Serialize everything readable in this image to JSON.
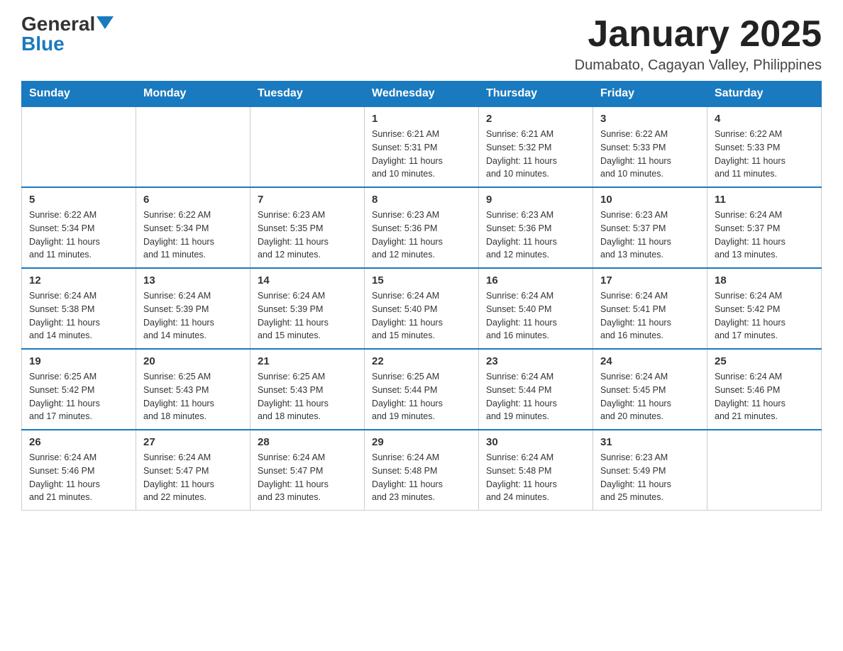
{
  "logo": {
    "general": "General",
    "triangle": "",
    "blue": "Blue"
  },
  "title": "January 2025",
  "subtitle": "Dumabato, Cagayan Valley, Philippines",
  "days_header": [
    "Sunday",
    "Monday",
    "Tuesday",
    "Wednesday",
    "Thursday",
    "Friday",
    "Saturday"
  ],
  "weeks": [
    [
      {
        "day": "",
        "info": ""
      },
      {
        "day": "",
        "info": ""
      },
      {
        "day": "",
        "info": ""
      },
      {
        "day": "1",
        "info": "Sunrise: 6:21 AM\nSunset: 5:31 PM\nDaylight: 11 hours\nand 10 minutes."
      },
      {
        "day": "2",
        "info": "Sunrise: 6:21 AM\nSunset: 5:32 PM\nDaylight: 11 hours\nand 10 minutes."
      },
      {
        "day": "3",
        "info": "Sunrise: 6:22 AM\nSunset: 5:33 PM\nDaylight: 11 hours\nand 10 minutes."
      },
      {
        "day": "4",
        "info": "Sunrise: 6:22 AM\nSunset: 5:33 PM\nDaylight: 11 hours\nand 11 minutes."
      }
    ],
    [
      {
        "day": "5",
        "info": "Sunrise: 6:22 AM\nSunset: 5:34 PM\nDaylight: 11 hours\nand 11 minutes."
      },
      {
        "day": "6",
        "info": "Sunrise: 6:22 AM\nSunset: 5:34 PM\nDaylight: 11 hours\nand 11 minutes."
      },
      {
        "day": "7",
        "info": "Sunrise: 6:23 AM\nSunset: 5:35 PM\nDaylight: 11 hours\nand 12 minutes."
      },
      {
        "day": "8",
        "info": "Sunrise: 6:23 AM\nSunset: 5:36 PM\nDaylight: 11 hours\nand 12 minutes."
      },
      {
        "day": "9",
        "info": "Sunrise: 6:23 AM\nSunset: 5:36 PM\nDaylight: 11 hours\nand 12 minutes."
      },
      {
        "day": "10",
        "info": "Sunrise: 6:23 AM\nSunset: 5:37 PM\nDaylight: 11 hours\nand 13 minutes."
      },
      {
        "day": "11",
        "info": "Sunrise: 6:24 AM\nSunset: 5:37 PM\nDaylight: 11 hours\nand 13 minutes."
      }
    ],
    [
      {
        "day": "12",
        "info": "Sunrise: 6:24 AM\nSunset: 5:38 PM\nDaylight: 11 hours\nand 14 minutes."
      },
      {
        "day": "13",
        "info": "Sunrise: 6:24 AM\nSunset: 5:39 PM\nDaylight: 11 hours\nand 14 minutes."
      },
      {
        "day": "14",
        "info": "Sunrise: 6:24 AM\nSunset: 5:39 PM\nDaylight: 11 hours\nand 15 minutes."
      },
      {
        "day": "15",
        "info": "Sunrise: 6:24 AM\nSunset: 5:40 PM\nDaylight: 11 hours\nand 15 minutes."
      },
      {
        "day": "16",
        "info": "Sunrise: 6:24 AM\nSunset: 5:40 PM\nDaylight: 11 hours\nand 16 minutes."
      },
      {
        "day": "17",
        "info": "Sunrise: 6:24 AM\nSunset: 5:41 PM\nDaylight: 11 hours\nand 16 minutes."
      },
      {
        "day": "18",
        "info": "Sunrise: 6:24 AM\nSunset: 5:42 PM\nDaylight: 11 hours\nand 17 minutes."
      }
    ],
    [
      {
        "day": "19",
        "info": "Sunrise: 6:25 AM\nSunset: 5:42 PM\nDaylight: 11 hours\nand 17 minutes."
      },
      {
        "day": "20",
        "info": "Sunrise: 6:25 AM\nSunset: 5:43 PM\nDaylight: 11 hours\nand 18 minutes."
      },
      {
        "day": "21",
        "info": "Sunrise: 6:25 AM\nSunset: 5:43 PM\nDaylight: 11 hours\nand 18 minutes."
      },
      {
        "day": "22",
        "info": "Sunrise: 6:25 AM\nSunset: 5:44 PM\nDaylight: 11 hours\nand 19 minutes."
      },
      {
        "day": "23",
        "info": "Sunrise: 6:24 AM\nSunset: 5:44 PM\nDaylight: 11 hours\nand 19 minutes."
      },
      {
        "day": "24",
        "info": "Sunrise: 6:24 AM\nSunset: 5:45 PM\nDaylight: 11 hours\nand 20 minutes."
      },
      {
        "day": "25",
        "info": "Sunrise: 6:24 AM\nSunset: 5:46 PM\nDaylight: 11 hours\nand 21 minutes."
      }
    ],
    [
      {
        "day": "26",
        "info": "Sunrise: 6:24 AM\nSunset: 5:46 PM\nDaylight: 11 hours\nand 21 minutes."
      },
      {
        "day": "27",
        "info": "Sunrise: 6:24 AM\nSunset: 5:47 PM\nDaylight: 11 hours\nand 22 minutes."
      },
      {
        "day": "28",
        "info": "Sunrise: 6:24 AM\nSunset: 5:47 PM\nDaylight: 11 hours\nand 23 minutes."
      },
      {
        "day": "29",
        "info": "Sunrise: 6:24 AM\nSunset: 5:48 PM\nDaylight: 11 hours\nand 23 minutes."
      },
      {
        "day": "30",
        "info": "Sunrise: 6:24 AM\nSunset: 5:48 PM\nDaylight: 11 hours\nand 24 minutes."
      },
      {
        "day": "31",
        "info": "Sunrise: 6:23 AM\nSunset: 5:49 PM\nDaylight: 11 hours\nand 25 minutes."
      },
      {
        "day": "",
        "info": ""
      }
    ]
  ]
}
